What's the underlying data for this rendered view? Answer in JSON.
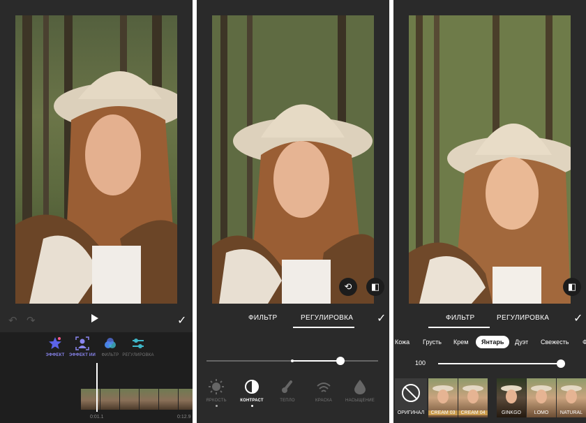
{
  "panel1": {
    "tools": [
      {
        "label": "ЭФФЕКТ",
        "icon": "star-icon"
      },
      {
        "label": "ЭФФЕКТ ИИ",
        "icon": "ai-person-icon"
      },
      {
        "label": "ФИЛЬТР",
        "icon": "filter-circles-icon"
      },
      {
        "label": "РЕГУЛИРОВКА",
        "icon": "sliders-icon"
      }
    ],
    "time_current": "0:01.1",
    "time_total": "0:12.9"
  },
  "panel2": {
    "tab_filter": "ФИЛЬТР",
    "tab_adjust": "РЕГУЛИРОВКА",
    "adjust_items": [
      {
        "label": "ЯРКОСТЬ",
        "icon": "sun-icon"
      },
      {
        "label": "КОНТРАСТ",
        "icon": "contrast-icon"
      },
      {
        "label": "ТЕПЛО",
        "icon": "thermometer-icon"
      },
      {
        "label": "КРАСКА",
        "icon": "wifi-icon"
      },
      {
        "label": "НАСЫЩЕНИЕ",
        "icon": "drop-icon"
      }
    ],
    "slider_value": 0.78
  },
  "panel3": {
    "tab_filter": "ФИЛЬТР",
    "tab_adjust": "РЕГУЛИРОВКА",
    "filters": [
      "Кожа",
      "Грусть",
      "Крем",
      "Янтарь",
      "Дуэт",
      "Свежесть",
      "Ф"
    ],
    "selected_filter": "Янтарь",
    "intensity": "100",
    "thumbs": [
      "ОРИГИНАЛ",
      "CREAM 03",
      "CREAM 04",
      "GINKGO",
      "LOMO",
      "NATURAL"
    ]
  },
  "colors": {
    "accent_purple": "#8a86f0",
    "accent_blue": "#4c8ef7"
  }
}
